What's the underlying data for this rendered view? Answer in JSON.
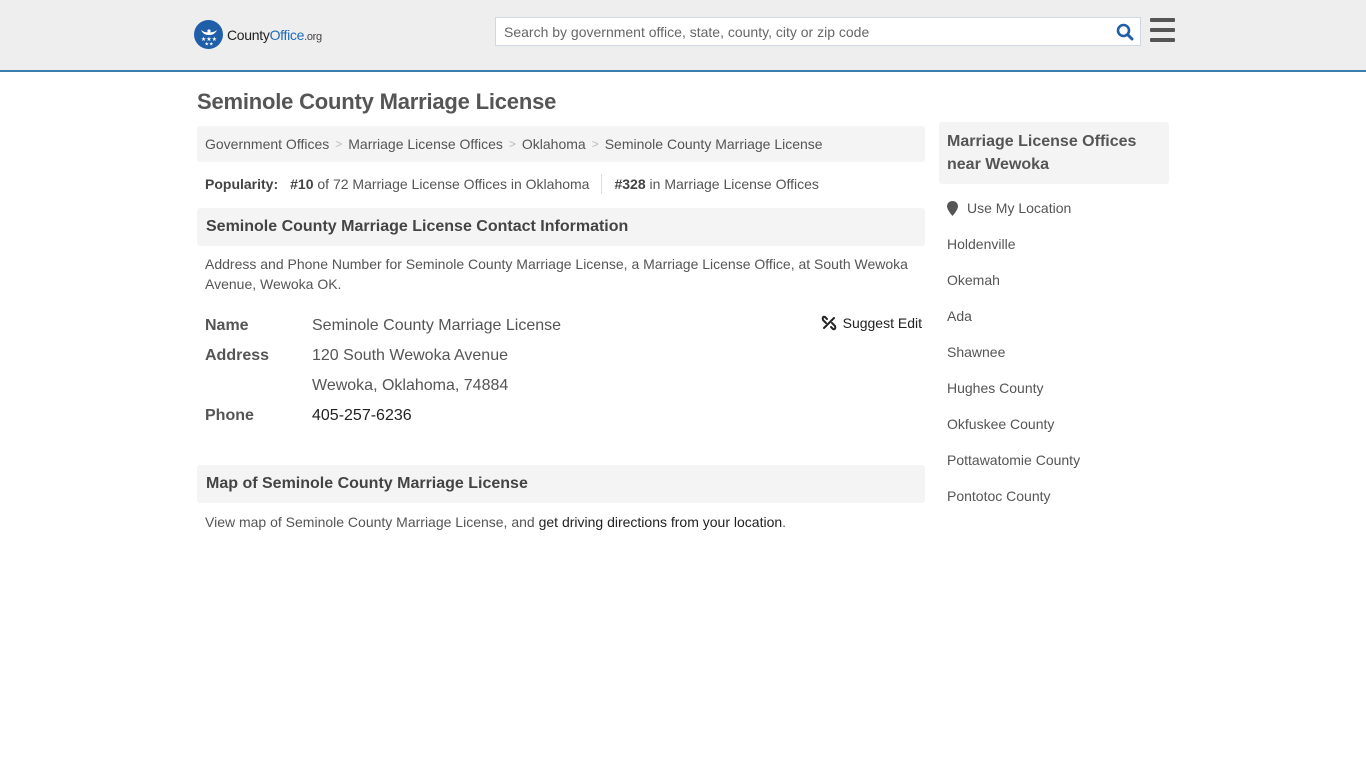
{
  "header": {
    "logo": {
      "county": "County",
      "office": "Office",
      "org": ".org",
      "brand_color": "#1f5fa8"
    },
    "search": {
      "placeholder": "Search by government office, state, county, city or zip code",
      "value": ""
    },
    "accent_color": "#3a7eb0"
  },
  "page": {
    "title": "Seminole County Marriage License",
    "breadcrumb": [
      {
        "label": "Government Offices"
      },
      {
        "label": "Marriage License Offices"
      },
      {
        "label": "Oklahoma"
      },
      {
        "label": "Seminole County Marriage License"
      }
    ],
    "breadcrumb_separator": ">",
    "popularity": {
      "label": "Popularity:",
      "state_rank": "#10",
      "state_text": "of 72 Marriage License Offices in Oklahoma",
      "national_rank": "#328",
      "national_text": "in Marriage License Offices"
    }
  },
  "contact": {
    "heading": "Seminole County Marriage License Contact Information",
    "description": "Address and Phone Number for Seminole County Marriage License, a Marriage License Office, at South Wewoka Avenue, Wewoka OK.",
    "suggest_edit": "Suggest Edit",
    "fields": {
      "name_label": "Name",
      "name_value": "Seminole County Marriage License",
      "address_label": "Address",
      "address_line1": "120 South Wewoka Avenue",
      "address_line2": "Wewoka, Oklahoma, 74884",
      "phone_label": "Phone",
      "phone_value": "405-257-6236"
    }
  },
  "map": {
    "heading": "Map of Seminole County Marriage License",
    "text": "View map of Seminole County Marriage License, and ",
    "link": "get driving directions from your location",
    "suffix": "."
  },
  "sidebar": {
    "heading": "Marriage License Offices near Wewoka",
    "use_location": "Use My Location",
    "items": [
      {
        "label": "Holdenville"
      },
      {
        "label": "Okemah"
      },
      {
        "label": "Ada"
      },
      {
        "label": "Shawnee"
      },
      {
        "label": "Hughes County"
      },
      {
        "label": "Okfuskee County"
      },
      {
        "label": "Pottawatomie County"
      },
      {
        "label": "Pontotoc County"
      }
    ]
  }
}
